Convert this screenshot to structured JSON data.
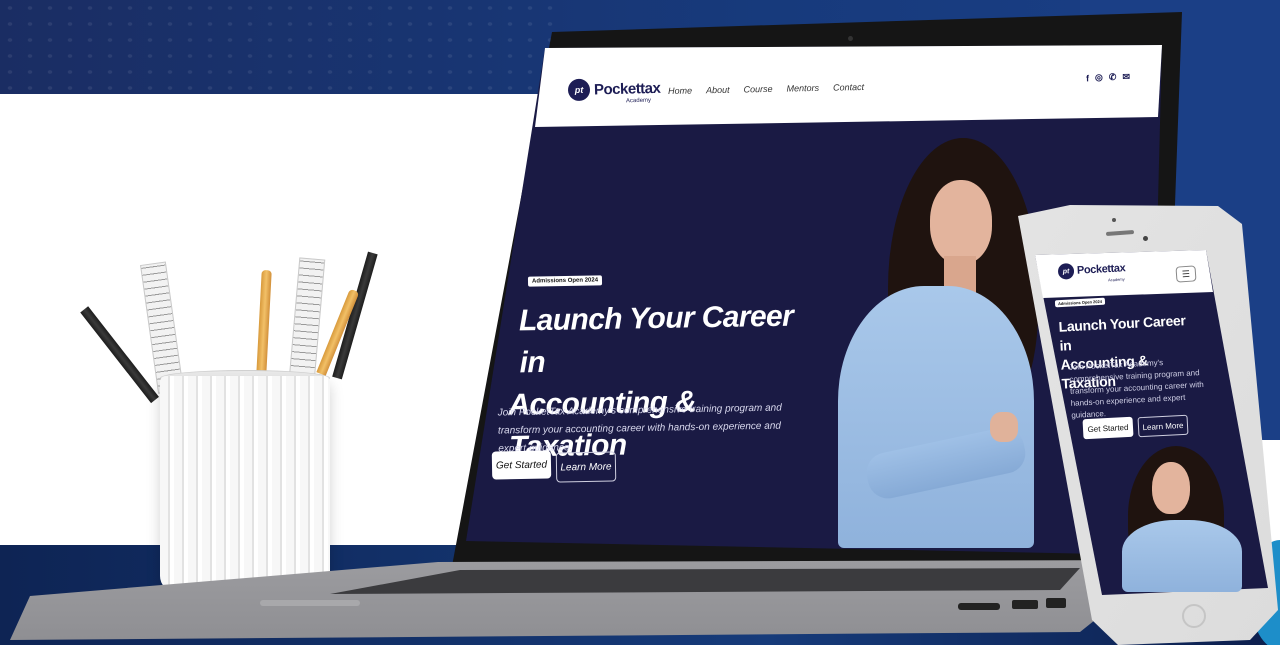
{
  "site": {
    "brand_name": "Pockettax",
    "brand_sub": "Academy",
    "logo_mark": "pt",
    "nav": [
      "Home",
      "About",
      "Course",
      "Mentors",
      "Contact"
    ],
    "social_icons": [
      "facebook-icon",
      "instagram-icon",
      "whatsapp-icon",
      "mail-icon"
    ],
    "social_glyphs": [
      "f",
      "◎",
      "✆",
      "✉"
    ],
    "hero": {
      "badge": "Admissions Open 2024",
      "title_line1": "Launch Your Career in",
      "title_line2": "Accounting & Taxation",
      "description": "Join PocketTax Academy's comprehensive training program and transform your accounting career with hands-on experience and expert guidance.",
      "primary_button": "Get Started",
      "secondary_button": "Learn More"
    }
  },
  "mobile": {
    "menu_icon": "hamburger-icon",
    "menu_glyph": "☰"
  },
  "colors": {
    "hero_bg": "#1a1a44",
    "brand": "#1d1d55",
    "page_accent": "#173a7c"
  }
}
